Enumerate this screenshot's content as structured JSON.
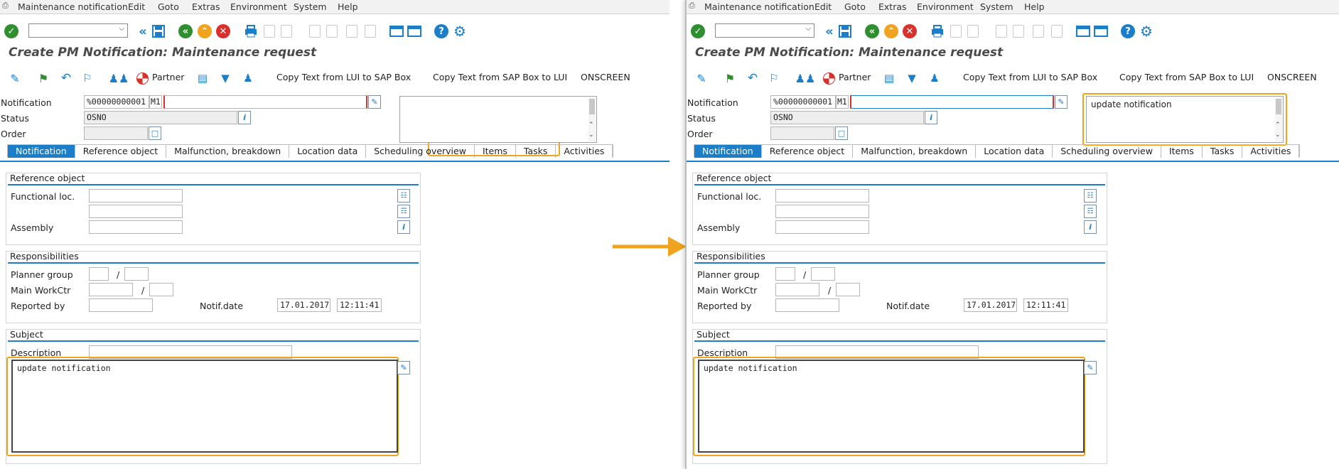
{
  "menu": [
    "Maintenance notification",
    "Edit",
    "Goto",
    "Extras",
    "Environment",
    "System",
    "Help"
  ],
  "title": "Create PM Notification: Maintenance request",
  "app_toolbar": {
    "partner": "Partner",
    "copy_lui_to_sap": "Copy Text from LUI to SAP Box",
    "copy_sap_to_lui": "Copy Text from SAP Box to LUI",
    "onscreen": "ONSCREEN"
  },
  "header": {
    "notification_label": "Notification",
    "notification_value": "%00000000001",
    "notification_type": "M1",
    "status_label": "Status",
    "status_value": "OSNO",
    "order_label": "Order"
  },
  "tabs": [
    "Notification",
    "Reference object",
    "Malfunction, breakdown",
    "Location data",
    "Scheduling overview",
    "Items",
    "Tasks",
    "Activities"
  ],
  "reference_object": {
    "title": "Reference object",
    "functional_loc_label": "Functional loc.",
    "assembly_label": "Assembly"
  },
  "responsibilities": {
    "title": "Responsibilities",
    "planner_group_label": "Planner group",
    "main_workctr_label": "Main WorkCtr",
    "reported_by_label": "Reported by",
    "notif_date_label": "Notif.date",
    "notif_date_value": "17.01.2017",
    "notif_time_value": "12:11:41",
    "slash": "/"
  },
  "subject": {
    "title": "Subject",
    "description_label": "Description",
    "long_text": "update notification"
  },
  "left_side_text": "",
  "right_side_text": "update notification",
  "colors": {
    "accent": "#1c7ec8",
    "highlight": "#f0a31e",
    "title": "#4a4a4a"
  }
}
